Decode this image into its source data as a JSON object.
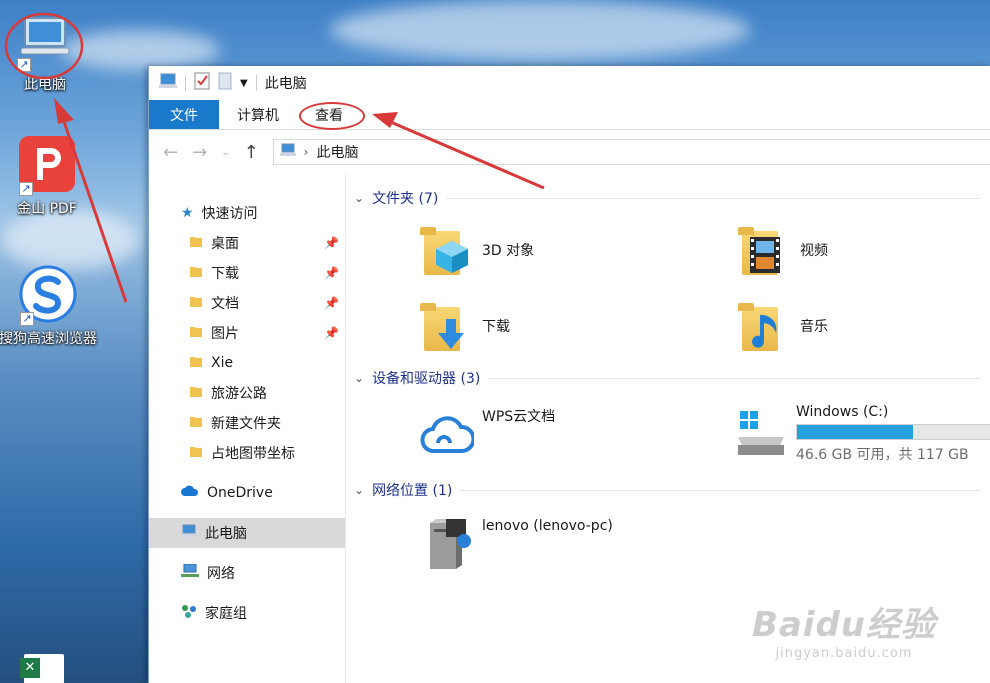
{
  "desktop": {
    "icons": [
      {
        "label": "此电脑"
      },
      {
        "label": "金山 PDF"
      },
      {
        "label": "搜狗高速浏览器"
      }
    ]
  },
  "window": {
    "title": "此电脑",
    "ribbon": {
      "tabs": [
        {
          "label": "文件"
        },
        {
          "label": "计算机"
        },
        {
          "label": "查看"
        }
      ]
    },
    "address": {
      "path": "此电脑"
    },
    "sidebar": {
      "quick_access": "快速访问",
      "items": [
        {
          "label": "桌面",
          "pinned": true
        },
        {
          "label": "下载",
          "pinned": true
        },
        {
          "label": "文档",
          "pinned": true
        },
        {
          "label": "图片",
          "pinned": true
        },
        {
          "label": "Xie",
          "pinned": false
        },
        {
          "label": "旅游公路",
          "pinned": false
        },
        {
          "label": "新建文件夹",
          "pinned": false
        },
        {
          "label": "占地图带坐标",
          "pinned": false
        }
      ],
      "onedrive": "OneDrive",
      "this_pc": "此电脑",
      "network": "网络",
      "homegroup": "家庭组"
    },
    "sections": {
      "folders": {
        "header": "文件夹 (7)",
        "items": [
          {
            "label": "3D 对象",
            "icon": "3d-objects-icon"
          },
          {
            "label": "视频",
            "icon": "video-folder-icon"
          },
          {
            "label": "下载",
            "icon": "download-folder-icon"
          },
          {
            "label": "音乐",
            "icon": "music-folder-icon"
          }
        ]
      },
      "devices": {
        "header": "设备和驱动器 (3)",
        "wps": {
          "label": "WPS云文档"
        },
        "drive": {
          "label": "Windows (C:)",
          "free_text": "46.6 GB 可用，共 117 GB",
          "used_fraction": 0.6
        }
      },
      "network": {
        "header": "网络位置 (1)",
        "items": [
          {
            "label": "lenovo (lenovo-pc)"
          }
        ]
      }
    }
  },
  "watermark": {
    "brand": "Baidu经验",
    "url": "jingyan.baidu.com"
  },
  "colors": {
    "accent": "#1979ca",
    "annotation": "#d83a3a",
    "drive_fill": "#26a0da"
  }
}
